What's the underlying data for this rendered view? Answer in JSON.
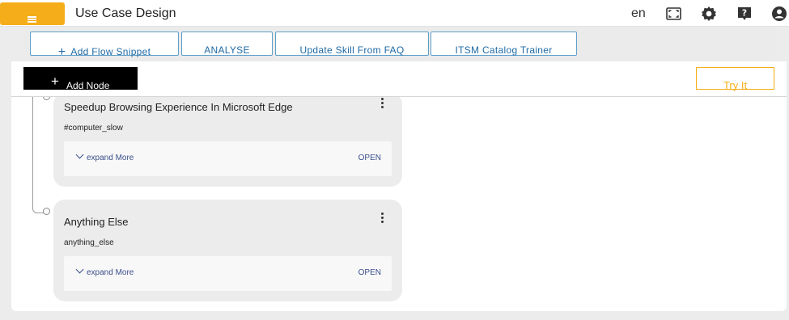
{
  "header": {
    "title": "Use Case Design",
    "language": "en",
    "menu_icon": "hamburger-icon",
    "icons": [
      "fit-screen-icon",
      "settings-gear-icon",
      "help-icon",
      "account-icon"
    ],
    "accent_color": "#f5ad19"
  },
  "toolbar": {
    "buttons": [
      {
        "label": "Add Flow Snippet",
        "icon": "plus-icon"
      },
      {
        "label": "ANALYSE"
      },
      {
        "label": "Update Skill From FAQ"
      },
      {
        "label": "ITSM Catalog Trainer"
      }
    ]
  },
  "actions": {
    "add_node": "Add Node",
    "try_it": "Try It"
  },
  "nodes": [
    {
      "title": "Speedup Browsing Experience In Microsoft Edge",
      "tag": "#computer_slow",
      "expand_label": "expand More",
      "open_label": "OPEN"
    },
    {
      "title": "Anything Else",
      "tag": "anything_else",
      "expand_label": "expand More",
      "open_label": "OPEN"
    }
  ]
}
